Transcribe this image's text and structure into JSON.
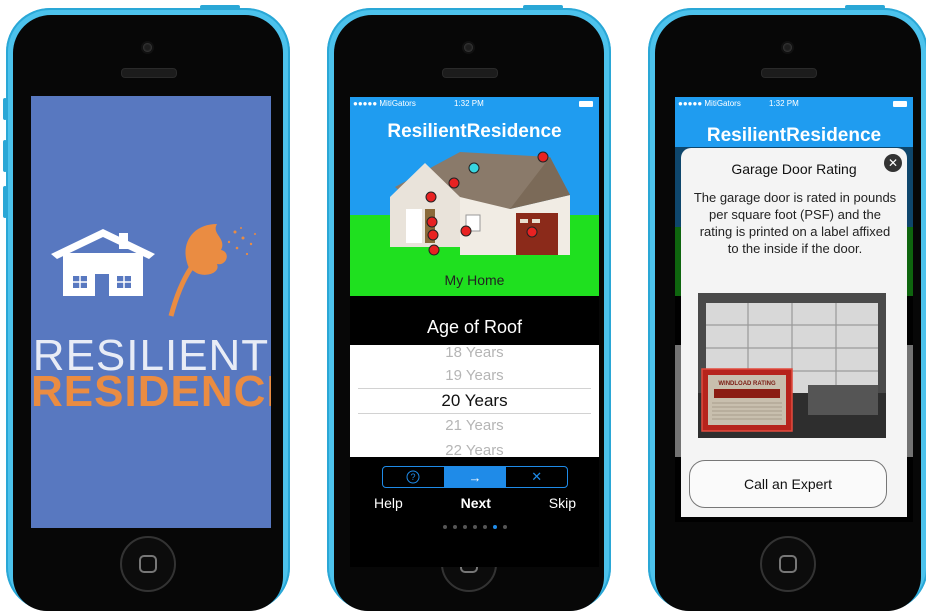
{
  "phone1": {
    "logo_line1": "RESILIENT",
    "logo_line2": "RESIDENCE"
  },
  "phone2": {
    "status": {
      "carrier": "●●●●● MitiGators",
      "time": "1:32 PM"
    },
    "app_title": "ResilientResidence",
    "hero_caption": "My Home",
    "question": "Age of Roof",
    "picker_options": [
      "18 Years",
      "19 Years",
      "20 Years",
      "21 Years",
      "22 Years"
    ],
    "selected_option": "20 Years",
    "actions": {
      "help": "Help",
      "next": "Next",
      "skip": "Skip"
    },
    "page_dots": {
      "count": 7,
      "active": 6
    }
  },
  "phone3": {
    "status": {
      "carrier": "●●●●● MitiGators",
      "time": "1:32 PM"
    },
    "app_title": "ResilientResidence",
    "modal": {
      "title": "Garage Door Rating",
      "body": "The garage door is rated in pounds per square foot (PSF) and the rating is printed on a label affixed to the inside if the door.",
      "photo_label_title": "WINDLOAD RATING",
      "cta": "Call an Expert"
    }
  },
  "colors": {
    "phone_shell": "#4cc2ec",
    "splash_bg": "#5878c0",
    "brand_orange": "#ea8c42",
    "sky": "#1f9cf0",
    "grass": "#1fe01f",
    "accent_blue": "#1f8be8",
    "marker_red": "#e82222",
    "marker_cyan": "#38d6e0"
  }
}
